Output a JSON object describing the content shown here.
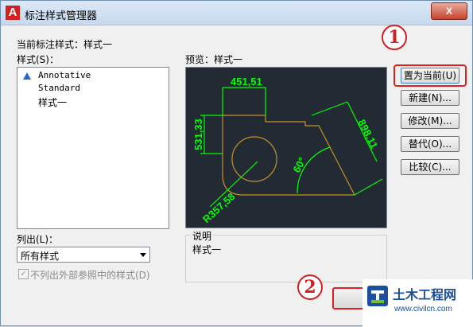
{
  "window": {
    "title": "标注样式管理器",
    "app_icon_letter": "A",
    "close_label": "X"
  },
  "current_style_label": "当前标注样式：样式一",
  "styles_label": "样式(S)：",
  "styles": [
    "Annotative",
    "Standard",
    "样式一"
  ],
  "preview_label": "预览：样式一",
  "preview": {
    "dim_top": "451,51",
    "dim_left": "531,33",
    "dim_right": "898,11",
    "dim_angle": "60°",
    "dim_radius": "R357,58"
  },
  "list_label": "列出(L)：",
  "list_select_value": "所有样式",
  "exclude_xref_label": "不列出外部参照中的样式(D)",
  "description_label": "说明",
  "description_value": "样式一",
  "buttons": {
    "set_current": "置为当前(U)",
    "new": "新建(N)...",
    "modify": "修改(M)...",
    "override": "替代(O)...",
    "compare": "比较(C)..."
  },
  "annotations": {
    "step1": "1",
    "step2": "2"
  },
  "watermark": {
    "text": "土木工程网",
    "url": "www.civilcn.com"
  },
  "colors": {
    "preview_bg": "#222b33",
    "dim_green": "#00ff00",
    "geometry_orange": "#c8902a",
    "highlight_red": "#e02020"
  }
}
